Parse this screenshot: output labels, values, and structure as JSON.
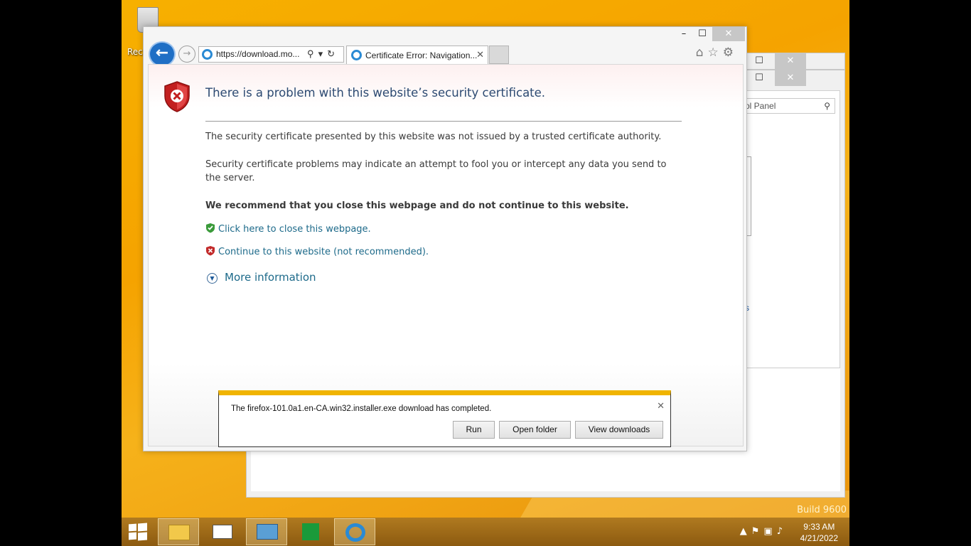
{
  "desktop": {
    "recycle_label": "Rec",
    "build": "Build 9600"
  },
  "control_panel": {
    "search_placeholder": "ol Panel",
    "truncated_link": "s"
  },
  "ie": {
    "address": "https://download.mo...",
    "tab_title": "Certificate Error: Navigation...",
    "heading": "There is a problem with this website’s security certificate.",
    "p1": "The security certificate presented by this website was not issued by a trusted certificate authority.",
    "p2": "Security certificate problems may indicate an attempt to fool you or intercept any data you send to the server.",
    "recommend": "We recommend that you close this webpage and do not continue to this website.",
    "close_link": "Click here to close this webpage.",
    "continue_link": "Continue to this website (not recommended).",
    "more_info": "More information"
  },
  "download_bar": {
    "message": "The firefox-101.0a1.en-CA.win32.installer.exe download has completed.",
    "run": "Run",
    "open_folder": "Open folder",
    "view_downloads": "View downloads"
  },
  "taskbar": {
    "time": "9:33 AM",
    "date": "4/21/2022"
  },
  "colors": {
    "accent": "#f0b400",
    "link": "#1d6a8a",
    "heading": "#2c4a72"
  }
}
